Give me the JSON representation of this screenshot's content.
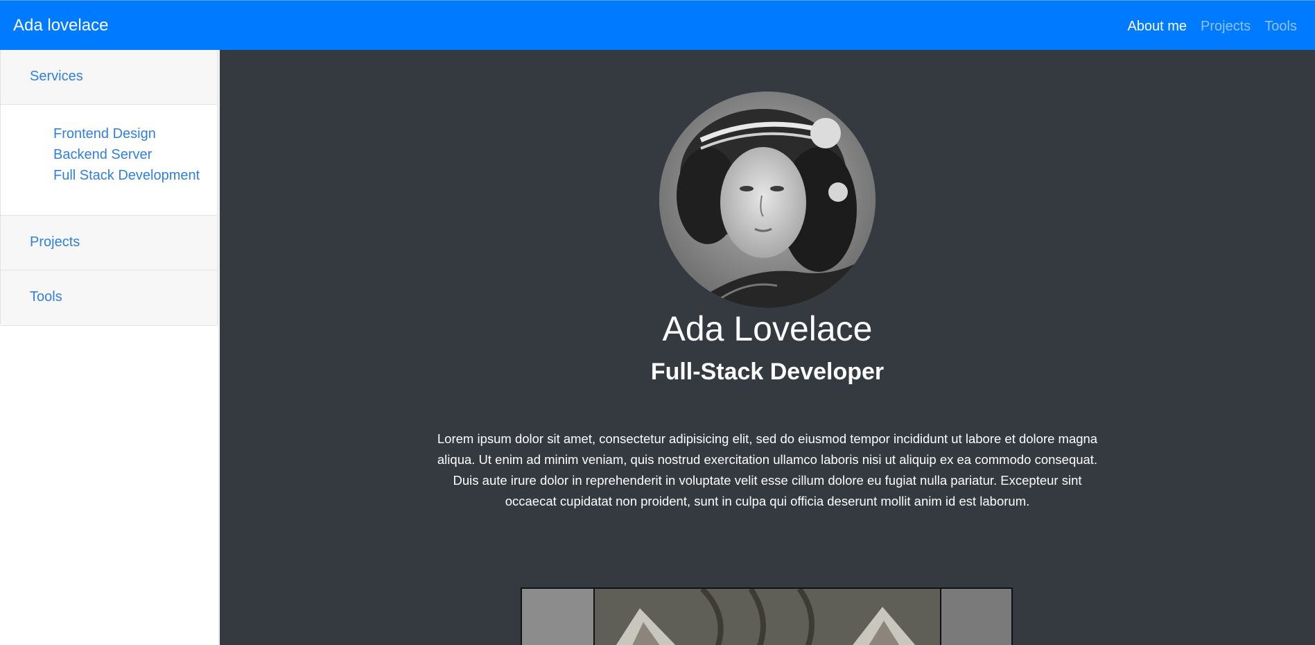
{
  "navbar": {
    "brand": "Ada lovelace",
    "links": [
      {
        "label": "About me",
        "active": true
      },
      {
        "label": "Projects",
        "active": false
      },
      {
        "label": "Tools",
        "active": false
      }
    ]
  },
  "sidebar": {
    "sections": [
      {
        "label": "Services",
        "items": [
          "Frontend Design",
          "Backend Server",
          "Full Stack Development"
        ]
      },
      {
        "label": "Projects"
      },
      {
        "label": "Tools"
      }
    ]
  },
  "profile": {
    "name": "Ada Lovelace",
    "title": "Full-Stack Developer",
    "bio": "Lorem ipsum dolor sit amet, consectetur adipisicing elit, sed do eiusmod tempor incididunt ut labore et dolore magna aliqua. Ut enim ad minim veniam, quis nostrud exercitation ullamco laboris nisi ut aliquip ex ea commodo consequat. Duis aute irure dolor in reprehenderit in voluptate velit esse cillum dolore eu fugiat nulla pariatur. Excepteur sint occaecat cupidatat non proident, sunt in culpa qui officia deserunt mollit anim id est laborum."
  },
  "colors": {
    "navbar": "#007bff",
    "main_bg": "#343a40",
    "link": "#2f7fe0"
  }
}
